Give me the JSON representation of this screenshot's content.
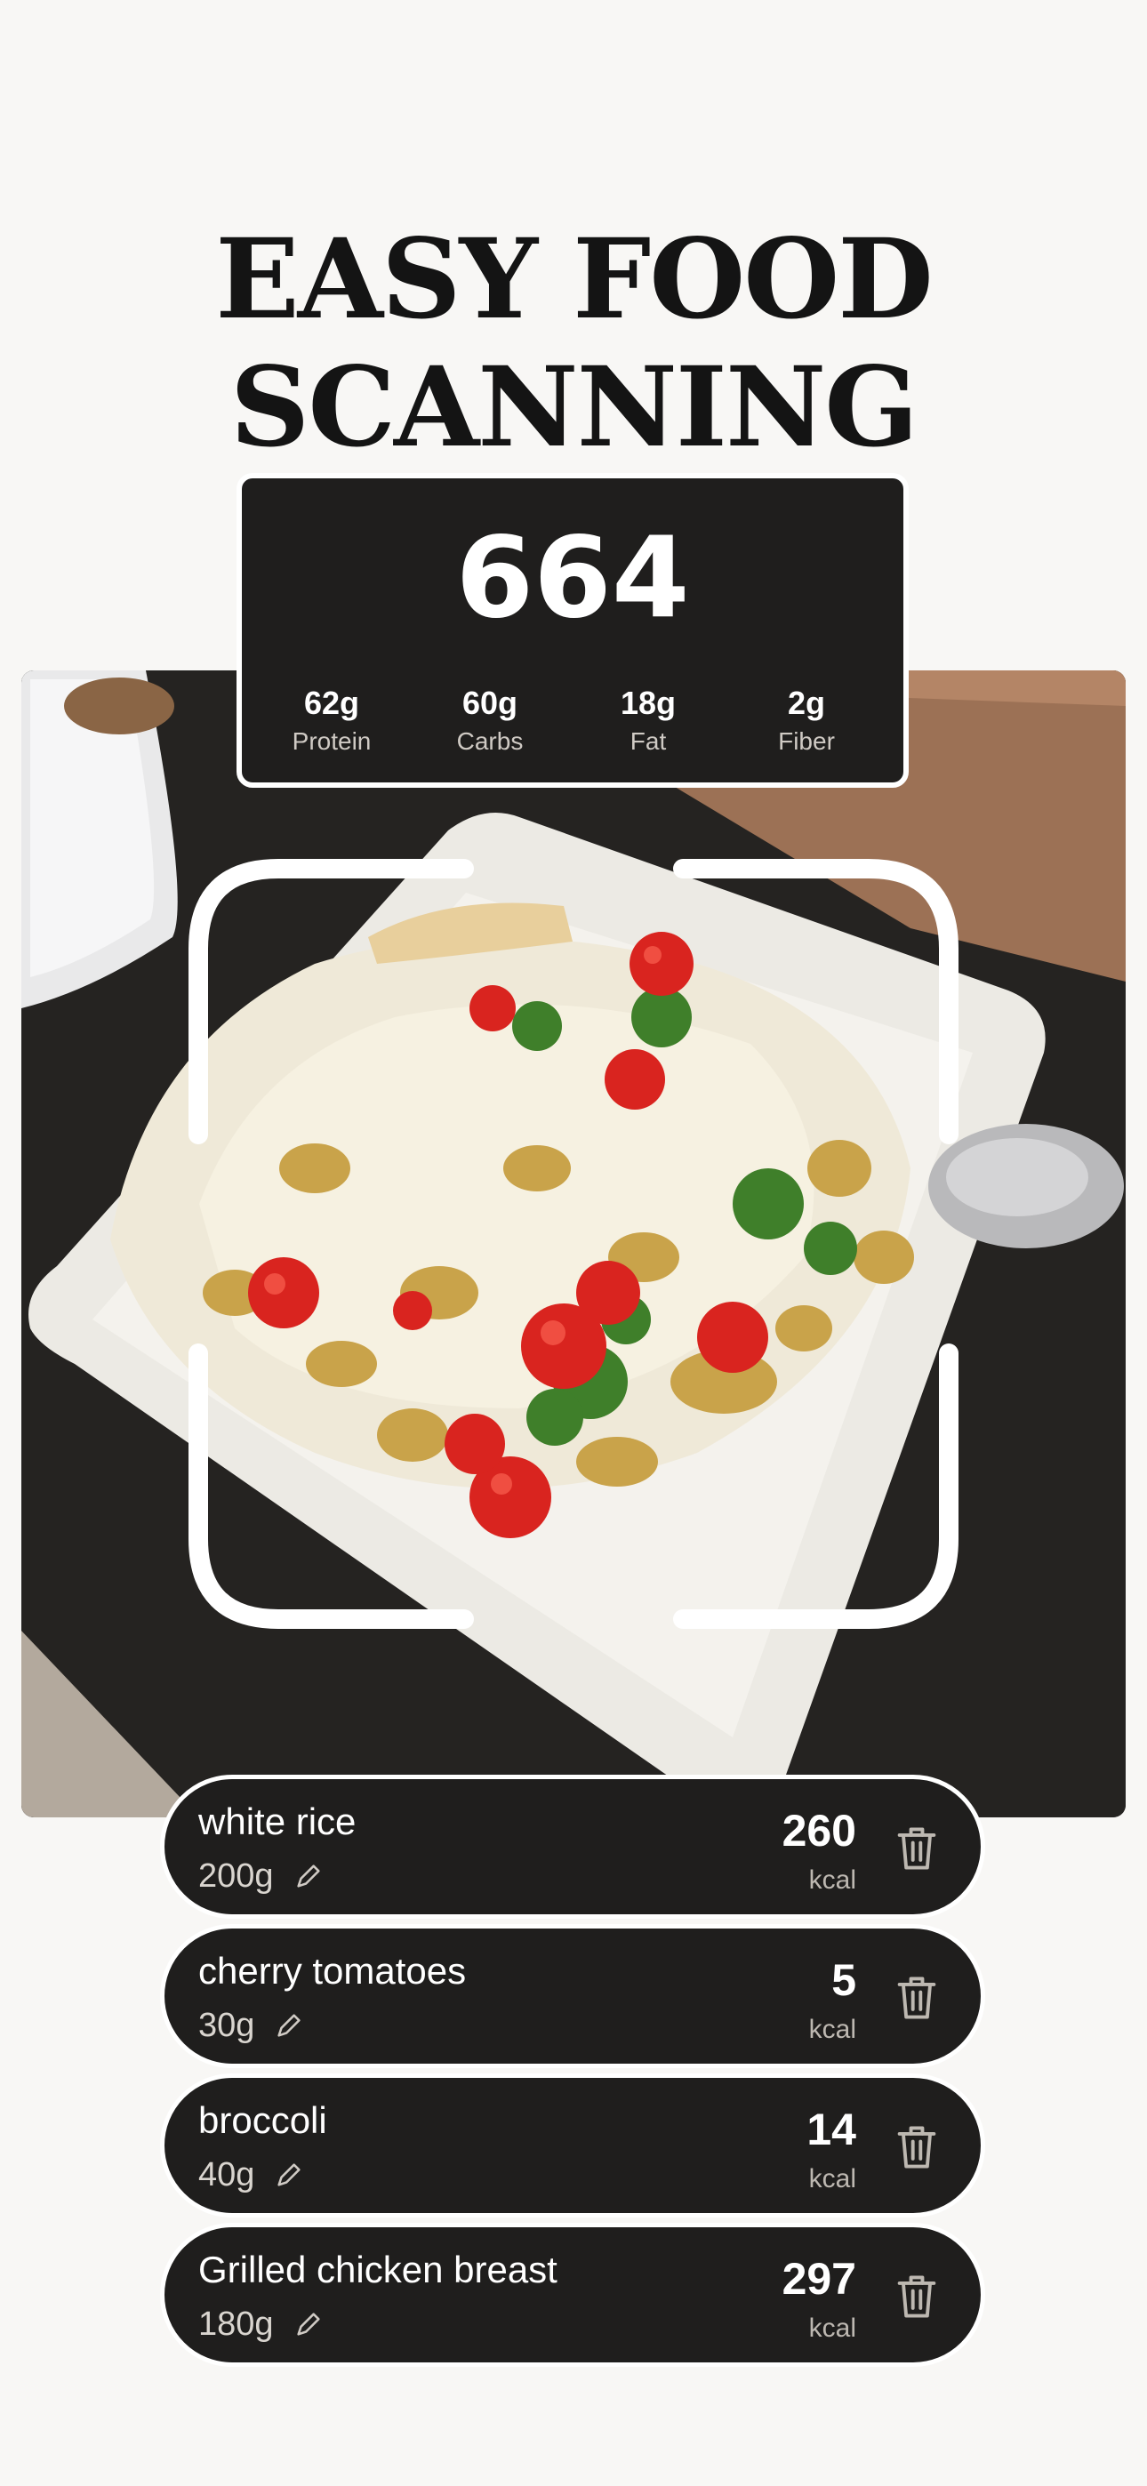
{
  "headline": {
    "line1": "EASY FOOD",
    "line2": "SCANNING"
  },
  "summary": {
    "calories": "664",
    "macros": [
      {
        "value": "62g",
        "label": "Protein"
      },
      {
        "value": "60g",
        "label": "Carbs"
      },
      {
        "value": "18g",
        "label": "Fat"
      },
      {
        "value": "2g",
        "label": "Fiber"
      }
    ]
  },
  "items": [
    {
      "name": "white rice",
      "weight": "200g",
      "kcal": "260",
      "unit": "kcal"
    },
    {
      "name": "cherry tomatoes",
      "weight": "30g",
      "kcal": "5",
      "unit": "kcal"
    },
    {
      "name": "broccoli",
      "weight": "40g",
      "kcal": "14",
      "unit": "kcal"
    },
    {
      "name": "Grilled chicken breast",
      "weight": "180g",
      "kcal": "297",
      "unit": "kcal"
    }
  ],
  "icons": {
    "edit": "pencil-icon",
    "delete": "trash-icon"
  },
  "colors": {
    "background": "#f8f7f5",
    "card": "#1f1e1d",
    "text": "#141414",
    "card_text": "#ffffff"
  }
}
